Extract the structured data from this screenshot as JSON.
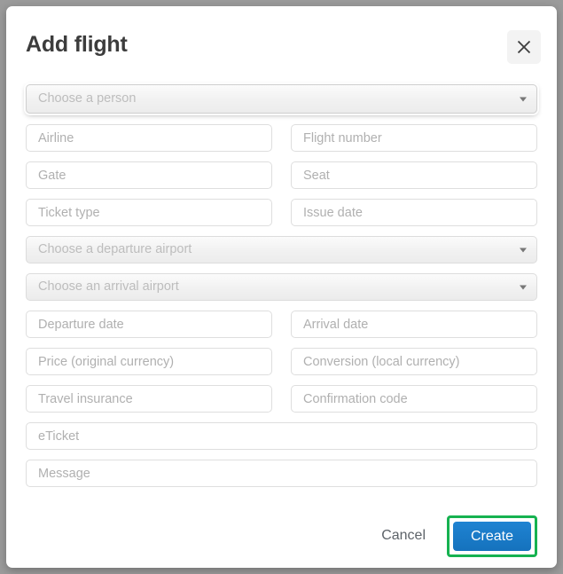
{
  "dialog": {
    "title": "Add flight",
    "close_icon": "close-icon"
  },
  "form": {
    "person_select": {
      "placeholder": "Choose a person",
      "caret_icon": "chevron-down-icon"
    },
    "departure_airport_select": {
      "placeholder": "Choose a departure airport",
      "caret_icon": "chevron-down-icon"
    },
    "arrival_airport_select": {
      "placeholder": "Choose an arrival airport",
      "caret_icon": "chevron-down-icon"
    },
    "fields": {
      "airline": "Airline",
      "flight_number": "Flight number",
      "gate": "Gate",
      "seat": "Seat",
      "ticket_type": "Ticket type",
      "issue_date": "Issue date",
      "departure_date": "Departure date",
      "arrival_date": "Arrival date",
      "price_original": "Price (original currency)",
      "conversion_local": "Conversion (local currency)",
      "travel_insurance": "Travel insurance",
      "confirmation_code": "Confirmation code",
      "eticket": "eTicket",
      "message": "Message"
    },
    "values": {
      "airline": "",
      "flight_number": "",
      "gate": "",
      "seat": "",
      "ticket_type": "",
      "issue_date": "",
      "departure_date": "",
      "arrival_date": "",
      "price_original": "",
      "conversion_local": "",
      "travel_insurance": "",
      "confirmation_code": "",
      "eticket": "",
      "message": ""
    }
  },
  "footer": {
    "cancel_label": "Cancel",
    "create_label": "Create"
  },
  "colors": {
    "backdrop": "#9b9b9b",
    "dialog_background": "#ffffff",
    "title_text": "#3c3c3c",
    "placeholder_text": "#b0b0b0",
    "field_border": "#dedede",
    "cancel_text": "#5d6369",
    "create_button": "#1572bd",
    "highlight_ring": "#16b250"
  }
}
